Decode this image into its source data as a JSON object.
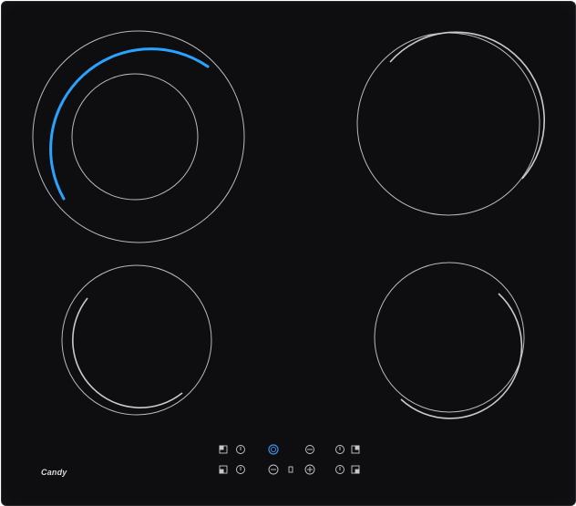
{
  "brand": {
    "logo_text": "Candy"
  },
  "colors": {
    "glass": "#0e0e10",
    "ring": "#bdbdc2",
    "heat": "#2aa3ff",
    "control": "#c8c8cc",
    "power_accent": "#3b8fe8"
  },
  "zones": [
    {
      "id": "front-left-large",
      "dual_ring": true,
      "active": true
    },
    {
      "id": "rear-right",
      "dual_ring": false,
      "active": false
    },
    {
      "id": "rear-left",
      "dual_ring": false,
      "active": false
    },
    {
      "id": "front-right",
      "dual_ring": false,
      "active": false
    }
  ],
  "controls": {
    "power_icon": "power-icon",
    "timer_icon": "timer-icon",
    "minus_icon": "minus-icon",
    "plus_icon": "plus-icon",
    "zone_select_icon": "zone-select-icon",
    "lock_icon": "lock-icon"
  }
}
